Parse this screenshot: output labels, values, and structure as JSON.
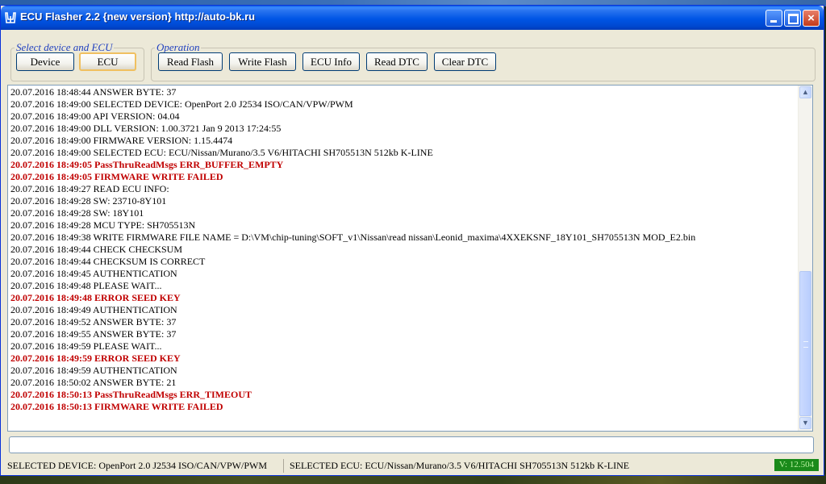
{
  "window": {
    "title": "ECU Flasher 2.2 {new version} http://auto-bk.ru",
    "icon": "honda-logo-icon",
    "controls": {
      "minimize": "minimize-icon",
      "maximize": "maximize-icon",
      "close": "×"
    }
  },
  "select_group": {
    "legend": "Select device and ECU",
    "buttons": [
      "Device",
      "ECU"
    ]
  },
  "operation_group": {
    "legend": "Operation",
    "buttons": [
      "Read Flash",
      "Write Flash",
      "ECU Info",
      "Read DTC",
      "Clear DTC"
    ]
  },
  "log": {
    "lines": [
      {
        "text": "20.07.2016 18:48:44 ANSWER BYTE: 37",
        "error": false
      },
      {
        "text": "20.07.2016 18:49:00 SELECTED DEVICE: OpenPort 2.0 J2534 ISO/CAN/VPW/PWM",
        "error": false
      },
      {
        "text": "20.07.2016 18:49:00 API VERSION: 04.04",
        "error": false
      },
      {
        "text": "20.07.2016 18:49:00 DLL VERSION: 1.00.3721 Jan  9 2013 17:24:55",
        "error": false
      },
      {
        "text": "20.07.2016 18:49:00 FIRMWARE VERSION: 1.15.4474",
        "error": false
      },
      {
        "text": "20.07.2016 18:49:00 SELECTED ECU: ECU/Nissan/Murano/3.5 V6/HITACHI SH705513N 512kb K-LINE",
        "error": false
      },
      {
        "text": "20.07.2016 18:49:05 PassThruReadMsgs ERR_BUFFER_EMPTY",
        "error": true
      },
      {
        "text": "20.07.2016 18:49:05 FIRMWARE WRITE FAILED",
        "error": true
      },
      {
        "text": "20.07.2016 18:49:27 READ ECU INFO:",
        "error": false
      },
      {
        "text": "20.07.2016 18:49:28 SW: 23710-8Y101",
        "error": false
      },
      {
        "text": "20.07.2016 18:49:28 SW: 18Y101",
        "error": false
      },
      {
        "text": "20.07.2016 18:49:28 MCU TYPE: SH705513N",
        "error": false
      },
      {
        "text": "20.07.2016 18:49:38 WRITE FIRMWARE FILE NAME = D:\\VM\\chip-tuning\\SOFT_v1\\Nissan\\read nissan\\Leonid_maxima\\4XXEKSNF_18Y101_SH705513N  MOD_E2.bin",
        "error": false
      },
      {
        "text": "20.07.2016 18:49:44 CHECK CHECKSUM",
        "error": false
      },
      {
        "text": "20.07.2016 18:49:44 CHECKSUM IS CORRECT",
        "error": false
      },
      {
        "text": "20.07.2016 18:49:45 AUTHENTICATION",
        "error": false
      },
      {
        "text": "20.07.2016 18:49:48 PLEASE WAIT...",
        "error": false
      },
      {
        "text": "20.07.2016 18:49:48 ERROR SEED KEY",
        "error": true
      },
      {
        "text": "20.07.2016 18:49:49 AUTHENTICATION",
        "error": false
      },
      {
        "text": "20.07.2016 18:49:52 ANSWER BYTE: 37",
        "error": false
      },
      {
        "text": "20.07.2016 18:49:55 ANSWER BYTE: 37",
        "error": false
      },
      {
        "text": "20.07.2016 18:49:59 PLEASE WAIT...",
        "error": false
      },
      {
        "text": "20.07.2016 18:49:59 ERROR SEED KEY",
        "error": true
      },
      {
        "text": "20.07.2016 18:49:59 AUTHENTICATION",
        "error": false
      },
      {
        "text": "20.07.2016 18:50:02 ANSWER BYTE: 21",
        "error": false
      },
      {
        "text": "20.07.2016 18:50:13 PassThruReadMsgs ERR_TIMEOUT",
        "error": true
      },
      {
        "text": "20.07.2016 18:50:13 FIRMWARE WRITE FAILED",
        "error": true
      }
    ],
    "scroll_up": "▲",
    "scroll_down": "▼",
    "error_color": "#c00000"
  },
  "command_input": {
    "value": ""
  },
  "statusbar": {
    "device": "SELECTED DEVICE: OpenPort 2.0 J2534 ISO/CAN/VPW/PWM",
    "ecu": "SELECTED ECU: ECU/Nissan/Murano/3.5 V6/HITACHI SH705513N 512kb K-LINE",
    "version": "V: 12.504"
  }
}
